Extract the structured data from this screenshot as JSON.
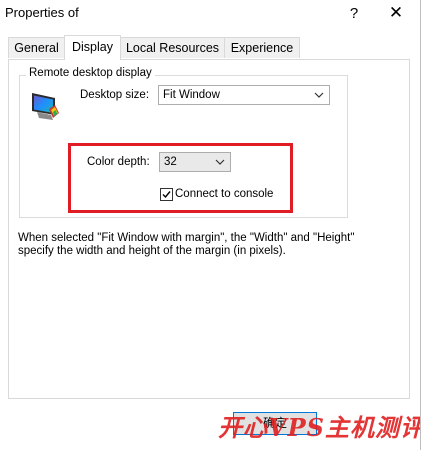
{
  "window": {
    "title": "Properties of",
    "help_glyph": "?",
    "close_glyph": "✕"
  },
  "tabs": [
    {
      "label": "General",
      "active": false
    },
    {
      "label": "Display",
      "active": true
    },
    {
      "label": "Local Resources",
      "active": false
    },
    {
      "label": "Experience",
      "active": false
    }
  ],
  "group": {
    "legend": "Remote desktop display",
    "desktop_size_label": "Desktop size:",
    "desktop_size_value": "Fit Window",
    "color_depth_label": "Color depth:",
    "color_depth_value": "32",
    "console_checkbox_label": "Connect to console",
    "console_checked": true
  },
  "info_text_line1": "When selected \"Fit Window with margin\", the \"Width\" and \"Height\"",
  "info_text_line2": "specify the width and height of the margin (in pixels).",
  "buttons": {
    "ok_label": "确定"
  },
  "watermark": "开心VPS主机测评",
  "colors": {
    "highlight_border": "#e01c24",
    "accent": "#0078d7"
  },
  "icons": [
    "monitor-icon",
    "chevron-down-icon",
    "checkmark-icon",
    "close-icon",
    "help-icon"
  ]
}
